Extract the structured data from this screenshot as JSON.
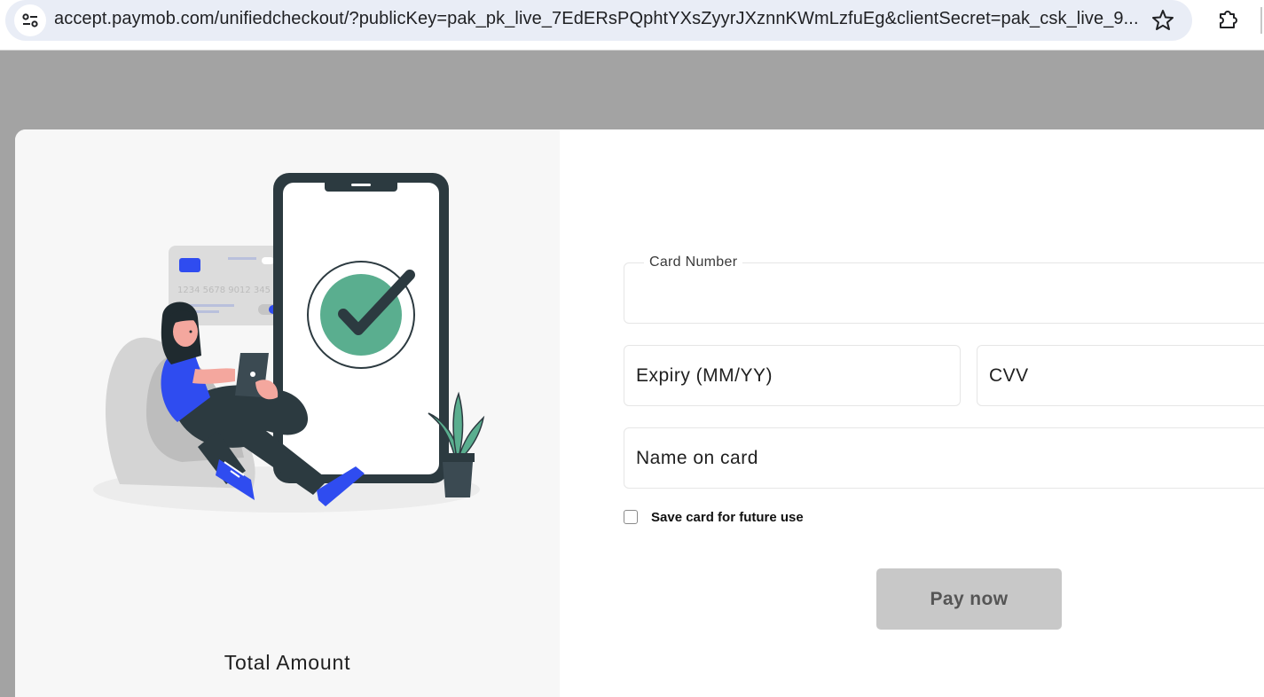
{
  "browser": {
    "url": "accept.paymob.com/unifiedcheckout/?publicKey=pak_pk_live_7EdERsPQphtYXsZyyrJXznnKWmLzfuEg&clientSecret=pak_csk_live_9...",
    "site_info_icon": "tune-icon",
    "bookmark_icon": "star-icon",
    "extensions_icon": "puzzle-icon"
  },
  "checkout": {
    "illustration_card_number": "1234 5678 9012 345",
    "total_label": "Total Amount",
    "card_number_label": "Card Number",
    "card_number_value": "",
    "expiry_placeholder": "Expiry (MM/YY)",
    "cvv_placeholder": "CVV",
    "name_placeholder": "Name on card",
    "save_card_label": "Save card for future use",
    "save_card_checked": false,
    "pay_button_label": "Pay now"
  },
  "colors": {
    "backdrop": "#a3a3a3",
    "left_pane": "#f7f7f7",
    "pay_button_disabled": "#c8c8c8",
    "success_green": "#5aae8f",
    "accent_blue": "#2f4cf0"
  }
}
